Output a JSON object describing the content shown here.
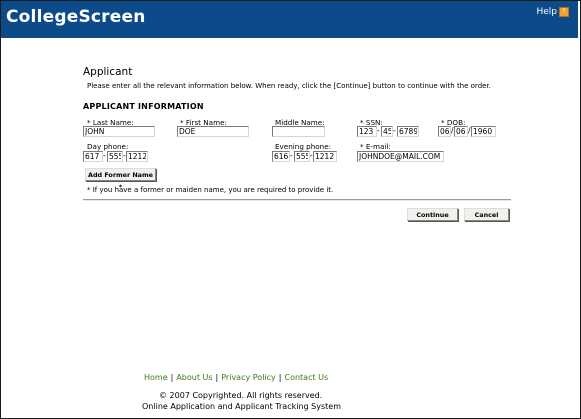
{
  "header": {
    "brand": "CollegeScreen",
    "help_label": "Help"
  },
  "page": {
    "title": "Applicant",
    "instructions": "Please enter all the relevant information below. When ready, click the [Continue] button to continue with the order.",
    "section_title": "APPLICANT INFORMATION"
  },
  "form": {
    "last_name": {
      "label": "* Last Name:",
      "value": "JOHN"
    },
    "first_name": {
      "label": "* First Name:",
      "value": "DOE"
    },
    "middle_name": {
      "label": "Middle Name:",
      "value": ""
    },
    "ssn": {
      "label": "* SSN:",
      "part1": "123",
      "part2": "45",
      "part3": "6789"
    },
    "dob": {
      "label": "* DOB:",
      "month": "06",
      "day": "06",
      "year": "1960"
    },
    "day_phone": {
      "label": "Day phone:",
      "area": "617",
      "prefix": "555",
      "line": "1212"
    },
    "evening_phone": {
      "label": "Evening phone:",
      "area": "616",
      "prefix": "555",
      "line": "1212"
    },
    "email": {
      "label": "* E-mail:",
      "value": "JOHNDOE@MAIL.COM"
    },
    "add_former_name_label": "Add Former Name *",
    "note": "* If you have a former or maiden name, you are required to provide it.",
    "continue_label": "Continue",
    "cancel_label": "Cancel"
  },
  "footer": {
    "links": [
      "Home",
      "About Us",
      "Privacy Policy",
      "Contact Us"
    ],
    "separator": "|",
    "copyright": "© 2007 Copyrighted. All rights reserved.",
    "tagline": "Online Application and Applicant Tracking System"
  },
  "colors": {
    "header_bg": "#0d4a8a",
    "footer_link": "#3b7a1f",
    "help_icon": "#f0a030"
  }
}
